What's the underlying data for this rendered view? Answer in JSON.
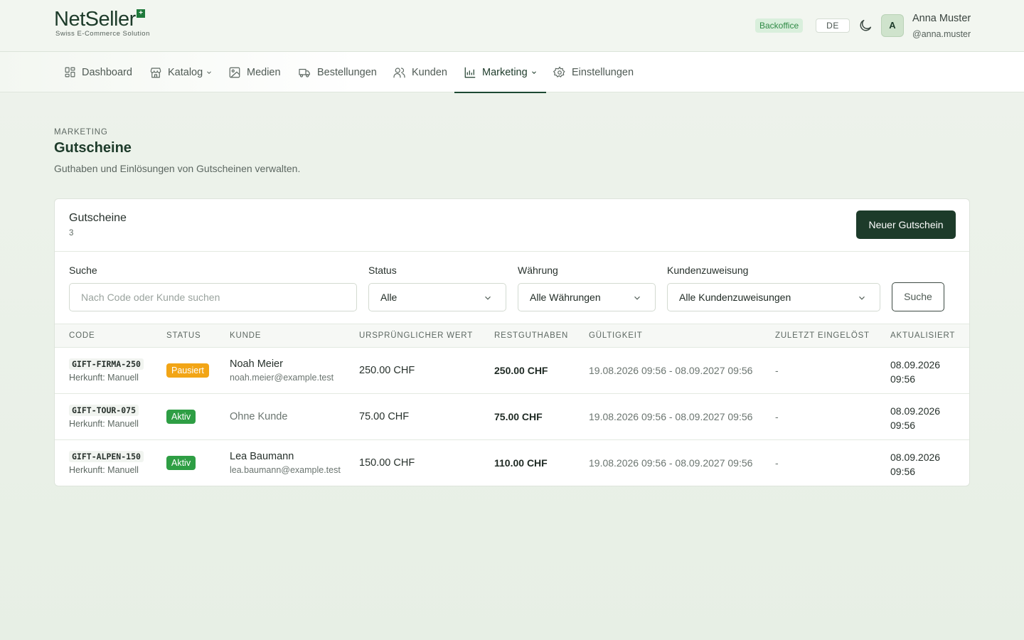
{
  "brand": {
    "name": "NetSeller",
    "plus": "+",
    "tagline": "Swiss E-Commerce Solution"
  },
  "header": {
    "env_badge": "Backoffice",
    "language": "DE",
    "user": {
      "initial": "A",
      "name": "Anna Muster",
      "handle": "@anna.muster"
    }
  },
  "nav": {
    "items": [
      {
        "label": "Dashboard",
        "icon": "dashboard-icon",
        "active": false
      },
      {
        "label": "Katalog",
        "icon": "store-icon",
        "active": false,
        "dropdown": true
      },
      {
        "label": "Medien",
        "icon": "image-icon",
        "active": false
      },
      {
        "label": "Bestellungen",
        "icon": "truck-icon",
        "active": false
      },
      {
        "label": "Kunden",
        "icon": "users-icon",
        "active": false
      },
      {
        "label": "Marketing",
        "icon": "chart-icon",
        "active": true,
        "dropdown": true
      },
      {
        "label": "Einstellungen",
        "icon": "gear-icon",
        "active": false
      }
    ]
  },
  "page": {
    "eyebrow": "MARKETING",
    "title": "Gutscheine",
    "description": "Guthaben und Einlösungen von Gutscheinen verwalten."
  },
  "card": {
    "title": "Gutscheine",
    "count": "3",
    "new_button": "Neuer Gutschein"
  },
  "filters": {
    "search": {
      "label": "Suche",
      "placeholder": "Nach Code oder Kunde suchen",
      "value": ""
    },
    "status": {
      "label": "Status",
      "value": "Alle"
    },
    "currency": {
      "label": "Währung",
      "value": "Alle Währungen"
    },
    "assignment": {
      "label": "Kundenzuweisung",
      "value": "Alle Kundenzuweisungen"
    },
    "submit": "Suche"
  },
  "table": {
    "columns": [
      "CODE",
      "STATUS",
      "KUNDE",
      "URSPRÜNGLICHER WERT",
      "RESTGUTHABEN",
      "GÜLTIGKEIT",
      "ZULETZT EINGELÖST",
      "AKTUALISIERT"
    ],
    "rows": [
      {
        "code": "GIFT-FIRMA-250",
        "origin": "Herkunft: Manuell",
        "status": "Pausiert",
        "customer": "Noah Meier",
        "email": "noah.meier@example.test",
        "original": "250.00 CHF",
        "remaining": "250.00 CHF",
        "validity": "19.08.2026 09:56 - 08.09.2027 09:56",
        "last_redeemed": "-",
        "updated": "08.09.2026 09:56"
      },
      {
        "code": "GIFT-TOUR-075",
        "origin": "Herkunft: Manuell",
        "status": "Aktiv",
        "customer": "Ohne Kunde",
        "email": "",
        "original": "75.00 CHF",
        "remaining": "75.00 CHF",
        "validity": "19.08.2026 09:56 - 08.09.2027 09:56",
        "last_redeemed": "-",
        "updated": "08.09.2026 09:56"
      },
      {
        "code": "GIFT-ALPEN-150",
        "origin": "Herkunft: Manuell",
        "status": "Aktiv",
        "customer": "Lea Baumann",
        "email": "lea.baumann@example.test",
        "original": "150.00 CHF",
        "remaining": "110.00 CHF",
        "validity": "19.08.2026 09:56 - 08.09.2027 09:56",
        "last_redeemed": "-",
        "updated": "08.09.2026 09:56"
      }
    ]
  },
  "colors": {
    "brand_dark": "#1d3b2a",
    "status_paused": "#f2a516",
    "status_active": "#2e9e44",
    "badge_bg": "#d9efdc"
  }
}
